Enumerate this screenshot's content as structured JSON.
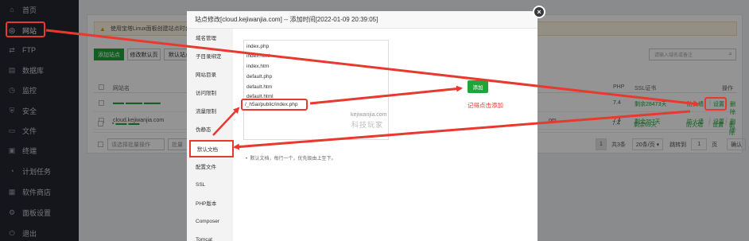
{
  "sidebar": {
    "items": [
      {
        "icon": "home-icon",
        "glyph": "⌂",
        "label": "首页"
      },
      {
        "icon": "globe-icon",
        "glyph": "◎",
        "label": "网站",
        "active": true
      },
      {
        "icon": "ftp-icon",
        "glyph": "⇄",
        "label": "FTP"
      },
      {
        "icon": "database-icon",
        "glyph": "▤",
        "label": "数据库"
      },
      {
        "icon": "monitor-icon",
        "glyph": "◷",
        "label": "监控"
      },
      {
        "icon": "shield-icon",
        "glyph": "⛨",
        "label": "安全"
      },
      {
        "icon": "folder-icon",
        "glyph": "▭",
        "label": "文件"
      },
      {
        "icon": "terminal-icon",
        "glyph": "▣",
        "label": "终端"
      },
      {
        "icon": "clock-icon",
        "glyph": "◔",
        "label": "计划任务"
      },
      {
        "icon": "store-icon",
        "glyph": "▦",
        "label": "软件商店"
      },
      {
        "icon": "settings-icon",
        "glyph": "⚙",
        "label": "面板设置"
      },
      {
        "icon": "logout-icon",
        "glyph": "⏻",
        "label": "退出"
      }
    ]
  },
  "main": {
    "warning": "使用宝塔Linux面板创建站点时会",
    "buttons": {
      "add_site": "添加站点",
      "modify_default": "修改默认页",
      "default_site": "默认站点"
    },
    "search_placeholder": "请输入域名或备注",
    "columns": {
      "site": "网站名",
      "php": "PHP",
      "ssl": "SSL证书",
      "ops": "操作"
    },
    "rows": [
      {
        "site": "▬▬ ▬▬▬ ▬▬▬",
        "tail": "",
        "php": "7.4",
        "ssl": "剩余28473天",
        "a": "防火墙",
        "b": "设置",
        "c": "删除"
      },
      {
        "site": "cloud.kejiwanjia.com",
        "tail": "om",
        "php": "7.4",
        "ssl": "剩余357天",
        "a": "防火墙",
        "b": "设置",
        "c": "删除"
      },
      {
        "site": "▪ ▬▬ ▬▬",
        "tail": "",
        "php": "7.4",
        "ssl": "剩余69天",
        "a": "防火墙",
        "b": "设置",
        "c": "删除"
      }
    ],
    "batch_select": "请选择批量操作",
    "batch_select2": "批量",
    "pager": {
      "page": "1",
      "total": "共3条",
      "per": "20条/页",
      "jump_label": "跳转到",
      "jump_value": "1",
      "page_unit": "页",
      "confirm": "确认"
    }
  },
  "modal": {
    "title": "站点修改[cloud.kejiwanjia.com] -- 添加时间[2022-01-09 20:39:05]",
    "close": "×",
    "menu": [
      "域名管理",
      "子目录绑定",
      "网站目录",
      "访问限制",
      "流量限制",
      "伪静态",
      "默认文档",
      "配置文件",
      "SSL",
      "PHP版本",
      "Composer",
      "Tomcat"
    ],
    "selected_menu": "默认文档",
    "files": [
      "index.php",
      "index.html",
      "index.htm",
      "default.php",
      "default.htm",
      "default.html"
    ],
    "new_entry": "/_h5ai/public/index.php",
    "add_button": "添加",
    "note": "记得点击添加",
    "tip": "默认文档，每行一个，优先级由上至下。",
    "watermark_url": "kejiwanjia.com",
    "watermark_cn": "科技玩家"
  },
  "colors": {
    "accent": "#20a53a",
    "annotation": "#e8392f",
    "sidebar": "#23262f"
  }
}
